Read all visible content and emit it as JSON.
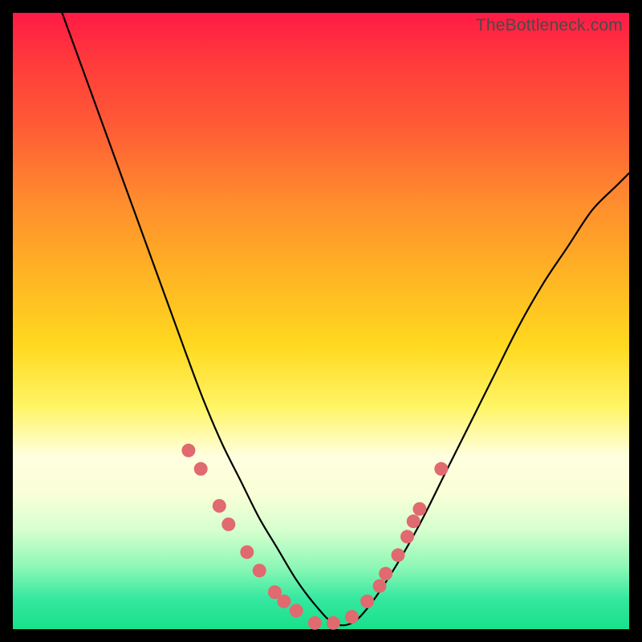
{
  "watermark": "TheBottleneck.com",
  "chart_data": {
    "type": "line",
    "title": "",
    "xlabel": "",
    "ylabel": "",
    "xlim": [
      0,
      100
    ],
    "ylim": [
      0,
      100
    ],
    "series": [
      {
        "name": "curve",
        "x": [
          8,
          12,
          16,
          20,
          24,
          28,
          31,
          34,
          37,
          40,
          43,
          46,
          49,
          52,
          55,
          58,
          62,
          66,
          70,
          74,
          78,
          82,
          86,
          90,
          94,
          98,
          100
        ],
        "y": [
          100,
          89,
          78,
          67,
          56,
          45,
          37,
          30,
          24,
          18,
          13,
          8,
          4,
          1,
          1,
          4,
          10,
          17,
          25,
          33,
          41,
          49,
          56,
          62,
          68,
          72,
          74
        ]
      }
    ],
    "markers": {
      "name": "highlight-points",
      "color": "#e06a6f",
      "x": [
        28.5,
        30.5,
        33.5,
        35.0,
        38.0,
        40.0,
        42.5,
        44.0,
        46.0,
        49.0,
        52.0,
        55.0,
        57.5,
        59.5,
        60.5,
        62.5,
        64.0,
        65.0,
        66.0,
        69.5
      ],
      "y": [
        29.0,
        26.0,
        20.0,
        17.0,
        12.5,
        9.5,
        6.0,
        4.5,
        3.0,
        1.0,
        1.0,
        2.0,
        4.5,
        7.0,
        9.0,
        12.0,
        15.0,
        17.5,
        19.5,
        26.0
      ]
    }
  }
}
